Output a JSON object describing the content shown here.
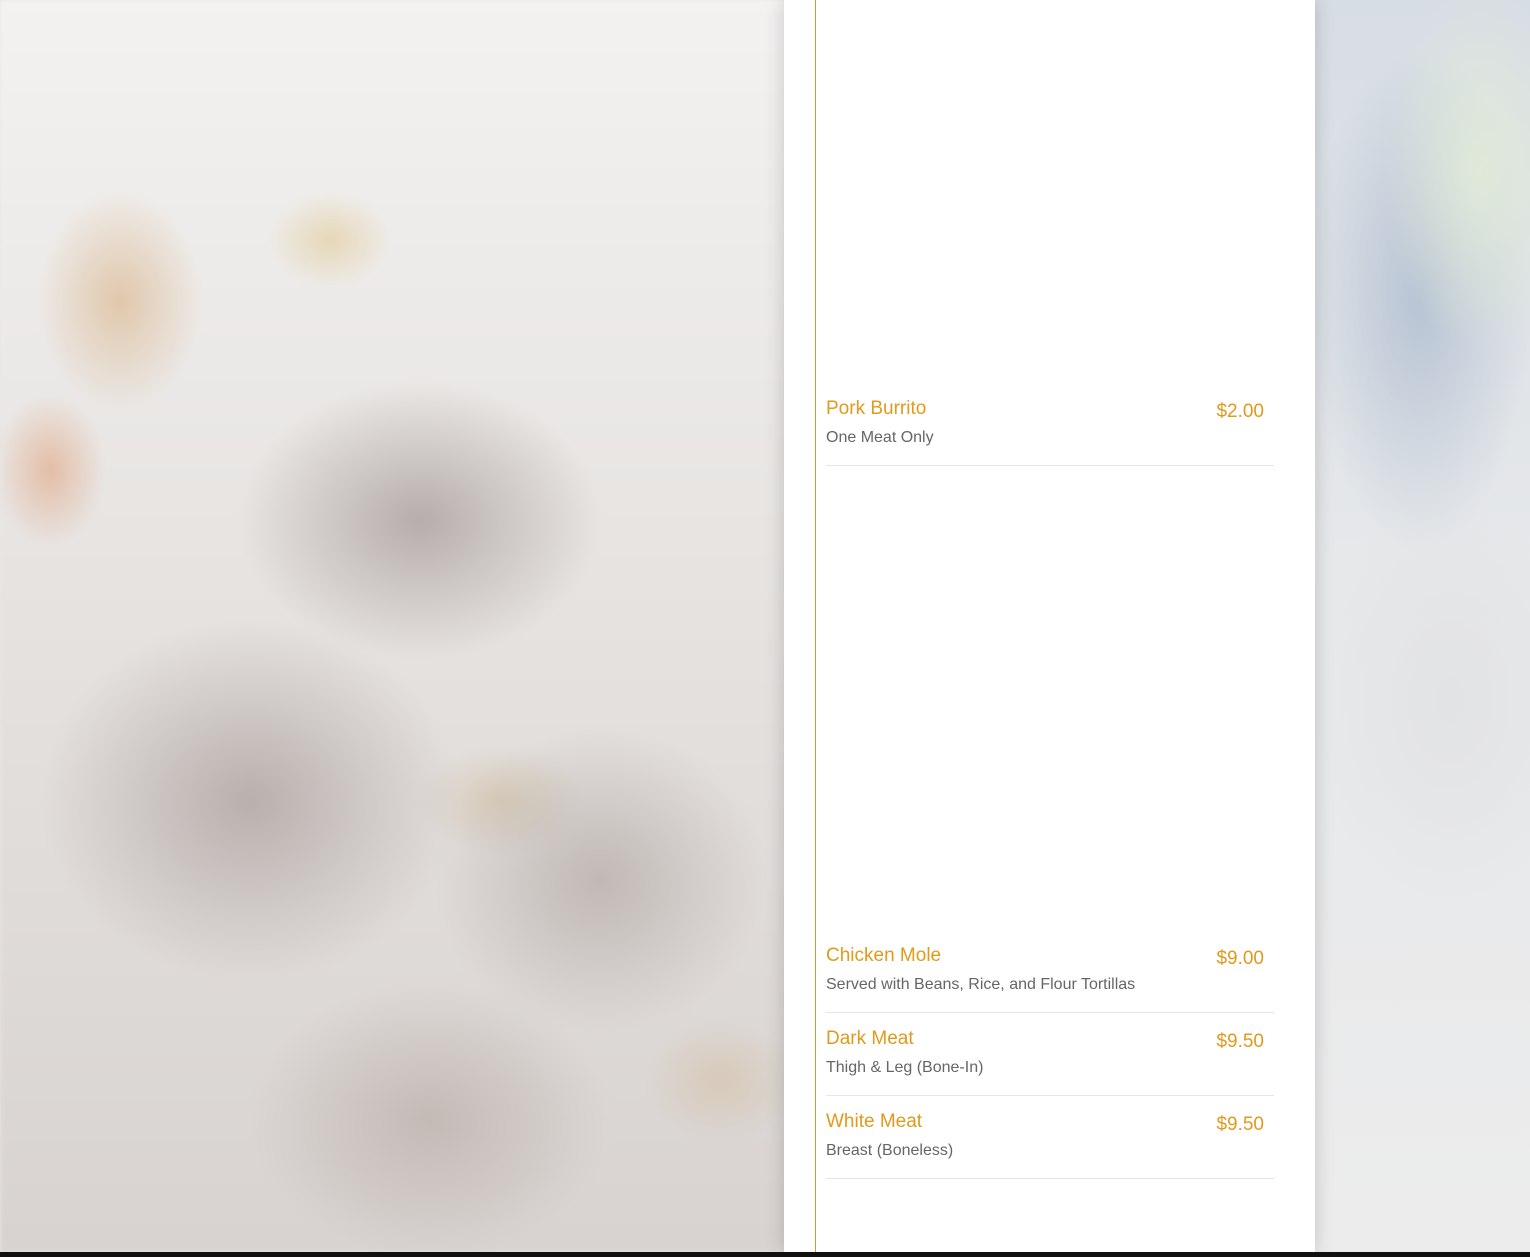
{
  "menu": {
    "items": [
      {
        "name": "Pork Burrito",
        "description": "One Meat Only",
        "price": "$2.00"
      },
      {
        "name": "Chicken Mole",
        "description": "Served with Beans, Rice, and Flour Tortillas",
        "price": "$9.00"
      },
      {
        "name": "Dark Meat",
        "description": "Thigh & Leg (Bone-In)",
        "price": "$9.50"
      },
      {
        "name": "White Meat",
        "description": "Breast (Boneless)",
        "price": "$9.50"
      }
    ],
    "colors": {
      "accent": "#e09a1c",
      "rule": "#d49a2a",
      "description": "#666666",
      "divider": "#e6e6e6"
    }
  }
}
